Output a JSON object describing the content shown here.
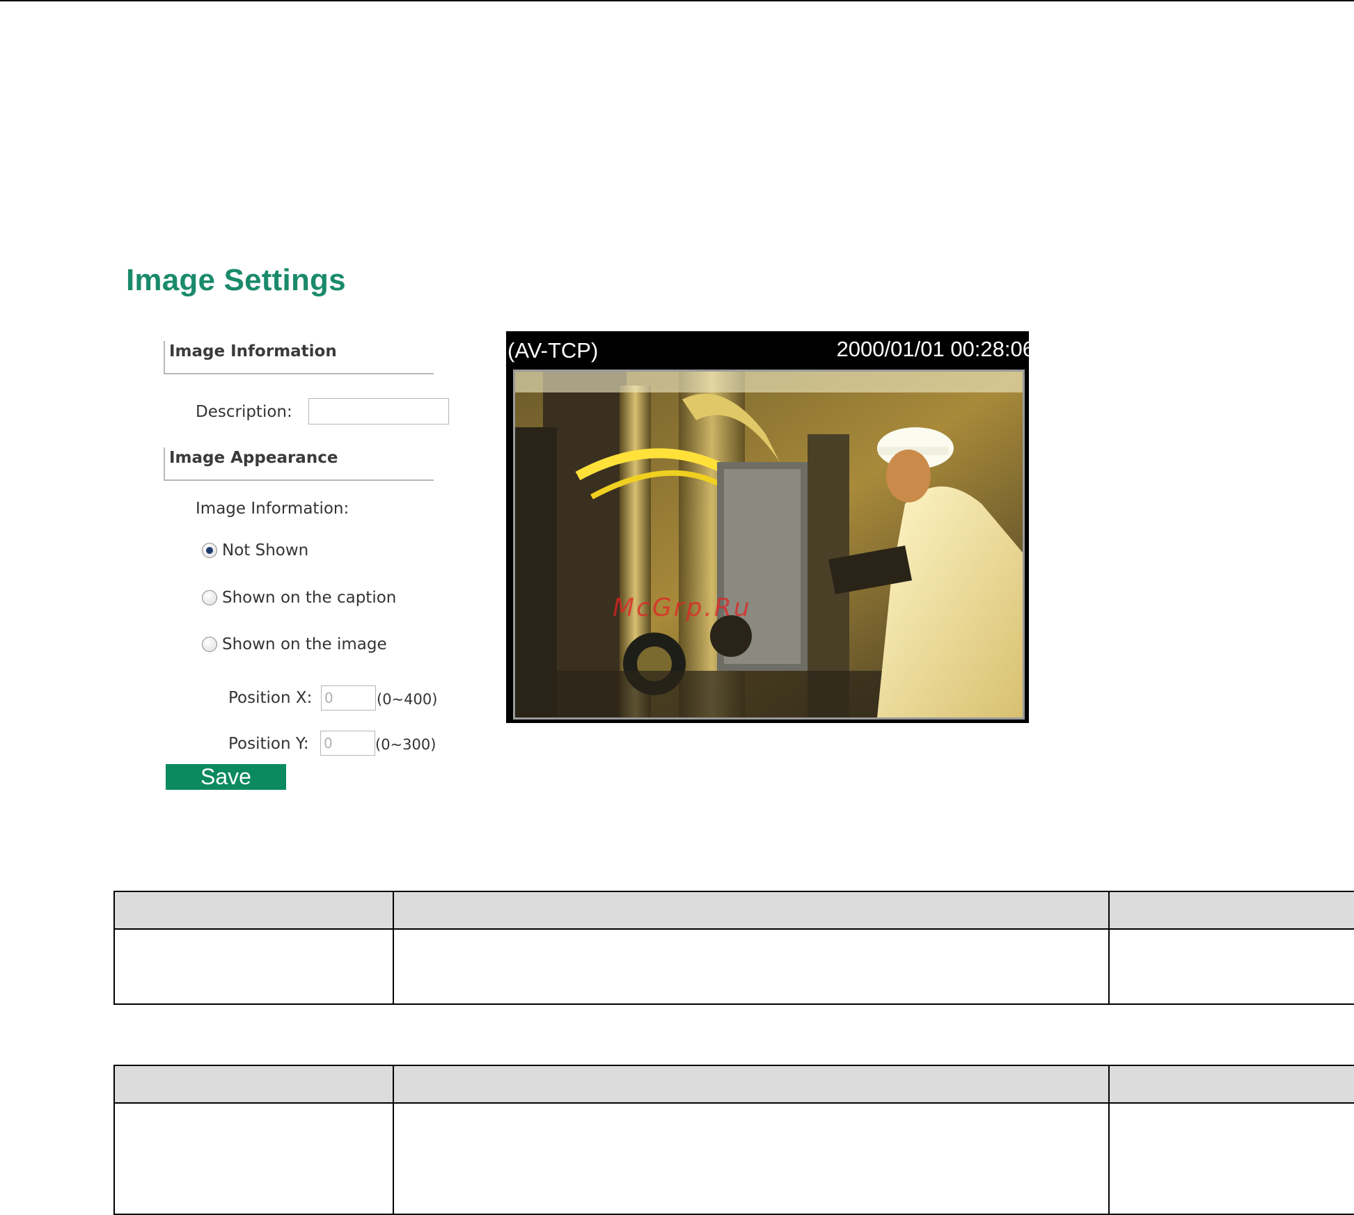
{
  "page": {
    "title": "Image Settings"
  },
  "image_information_section": {
    "header": "Image Information",
    "description_label": "Description:",
    "description_value": ""
  },
  "image_appearance_section": {
    "header": "Image Appearance",
    "image_information_label": "Image Information:",
    "options": [
      {
        "label": "Not Shown",
        "selected": true
      },
      {
        "label": "Shown on the caption",
        "selected": false
      },
      {
        "label": "Shown on the image",
        "selected": false
      }
    ],
    "position_x": {
      "label": "Position X:",
      "value": "0",
      "range": "(0~400)"
    },
    "position_y": {
      "label": "Position Y:",
      "value": "0",
      "range": "(0~300)"
    }
  },
  "save_label": "Save",
  "preview": {
    "caption_left": "(AV-TCP)",
    "caption_right": "2000/01/01 00:28:06"
  },
  "watermark": "McGrp.Ru",
  "colors": {
    "title_green": "#1a8a6a",
    "button_green": "#0b8a5f",
    "table_header_gray": "#dcdcdc"
  }
}
